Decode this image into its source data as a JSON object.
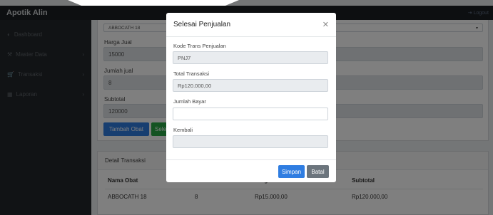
{
  "app": {
    "brand": "Apotik Alin",
    "logout": "Logout"
  },
  "sidebar": {
    "items": [
      {
        "label": "Dashboard",
        "icon": "dashboard-icon",
        "has_chevron": false
      },
      {
        "label": "Master Data",
        "icon": "wrench-icon",
        "has_chevron": true
      },
      {
        "label": "Transaksi",
        "icon": "cart-icon",
        "has_chevron": true
      },
      {
        "label": "Laporan",
        "icon": "table-icon",
        "has_chevron": true
      }
    ]
  },
  "form": {
    "obat_select": "ABBOCATH 18",
    "harga_jual_label": "Harga Jual",
    "harga_jual_value": "15000",
    "jumlah_label": "Jumlah jual",
    "jumlah_value": "8",
    "subtotal_label": "Subtotal",
    "subtotal_value": "120000",
    "btn_tambah": "Tambah Obat",
    "btn_selesai": "Selesai"
  },
  "detail": {
    "title": "Detail Transaksi",
    "columns": [
      "Nama Obat",
      "Jumlah",
      "Harga",
      "Subtotal"
    ],
    "rows": [
      [
        "ABBOCATH 18",
        "8",
        "Rp15.000,00",
        "Rp120.000,00"
      ]
    ]
  },
  "modal": {
    "title": "Selesai Penjualan",
    "kode_label": "Kode Trans Penjualan",
    "kode_value": "PNJ7",
    "total_label": "Total Transaksi",
    "total_value": "Rp120.000,00",
    "bayar_label": "Jumlah Bayar",
    "bayar_value": "",
    "kembali_label": "Kembali",
    "kembali_value": "",
    "btn_simpan": "Simpan",
    "btn_batal": "Batal"
  },
  "colors": {
    "primary": "#2f7de1",
    "success": "#28a745",
    "secondary": "#6c757d",
    "navbar": "#1b1e22",
    "sidebar": "#23272b"
  }
}
